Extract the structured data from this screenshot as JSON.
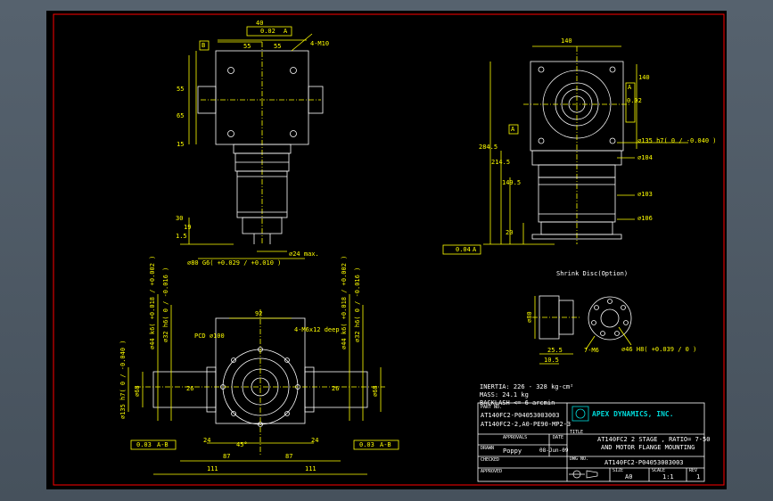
{
  "colors": {
    "frame": "#ff0000",
    "geometry": "#ffffff",
    "dimension": "#ffff00",
    "table": "#ffffff",
    "logo": "#00d8d8",
    "hidden": "#8a8a8a"
  },
  "top_view": {
    "datum_b": "B",
    "frame_top": "40",
    "frame_tol": "0.02",
    "frame_ref": "A",
    "dim_55_left": "55",
    "dim_55_right": "55",
    "dim_hole": "4-M10",
    "dim_v55": "55",
    "dim_v65": "65",
    "dim_15_bottom": "15",
    "dim_30": "30",
    "dim_19": "19",
    "dim_1_5": "1.5",
    "shaft_dia": "⌀80 G6( +0.029 / +0.010 )",
    "pilot_dia": "⌀24 max."
  },
  "side_view": {
    "frame_top": "140",
    "frame_right": "140",
    "frame_right_tol": "0.02",
    "frame_right_ref": "A",
    "dim_284_5": "284.5",
    "dim_214_5": "214.5",
    "dim_149_5": "149.5",
    "dim_20": "20",
    "datum_a": "A",
    "dia_135": "⌀135 h7( 0 / -0.040 )",
    "dia_104": "⌀104",
    "dia_103": "⌀103",
    "dia_106": "⌀106",
    "runout_tol": "0.04",
    "runout_ref": "A"
  },
  "front_view": {
    "label_pcd": "PCD ⌀100",
    "label_thread": "4-M6x12 deep",
    "dim_92": "92",
    "dia_44_left": "⌀44 k6( +0.018 / +0.002 )",
    "dia_32_left": "⌀32 h6( 0 / -0.016 )",
    "dia_44_right": "⌀44 k6( +0.018 / +0.002 )",
    "dia_32_right": "⌀32 h6( 0 / -0.016 )",
    "dia_135": "⌀135 h7( 0 / -0.040 )",
    "dia_68_left": "⌀68",
    "dia_68_right": "⌀68",
    "dim_26_left": "26",
    "dim_26_right": "26",
    "angle": "45°",
    "dim_24_left": "24",
    "dim_24_right": "24",
    "dim_87_left": "87",
    "dim_87_right": "87",
    "dim_111_left": "111",
    "dim_111_right": "111",
    "tol_left": "0.03",
    "tol_left_ref": "A-B",
    "tol_right": "0.03",
    "tol_right_ref": "A-B"
  },
  "shrink_disc": {
    "title": "Shrink Disc(Option)",
    "dia_80": "⌀80",
    "dim_25_5": "25.5",
    "dim_10_5": "10.5",
    "holes": "7-M6",
    "dia_46": "⌀46 H8( +0.039 / 0 )"
  },
  "notes": {
    "inertia": "INERTIA: 226 - 328 kg-cm²",
    "mass": "MASS: 24.1 kg",
    "backlash": "BACKLASH <= 6 arcmin"
  },
  "title_block": {
    "part_no_label": "PART NO.",
    "part_no_1": "AT140FC2-P04053003003",
    "part_no_2": "AT140FC2-2,A0-PE90-MP2-3",
    "company": "APEX DYNAMICS, INC.",
    "approvals_label": "APPROVALS",
    "date_label": "DATE",
    "title_label": "TITLE",
    "drawn_label": "DRAWN",
    "drawn_by": "Poppy",
    "drawn_date": "08-Jun-09",
    "title_line_1": "AT140FC2 2 STAGE , RATIO= 7-50",
    "title_line_2": "AND MOTOR FLANGE MOUNTING",
    "checked_label": "CHECKED",
    "dwg_no_label": "DWG NO.",
    "dwg_no": "AT140FC2-P04053003003",
    "approved_label": "APPROVED",
    "size_label": "SIZE",
    "size": "A0",
    "scale_label": "SCALE",
    "scale": "1:1",
    "rev_label": "REV",
    "rev": "1"
  }
}
